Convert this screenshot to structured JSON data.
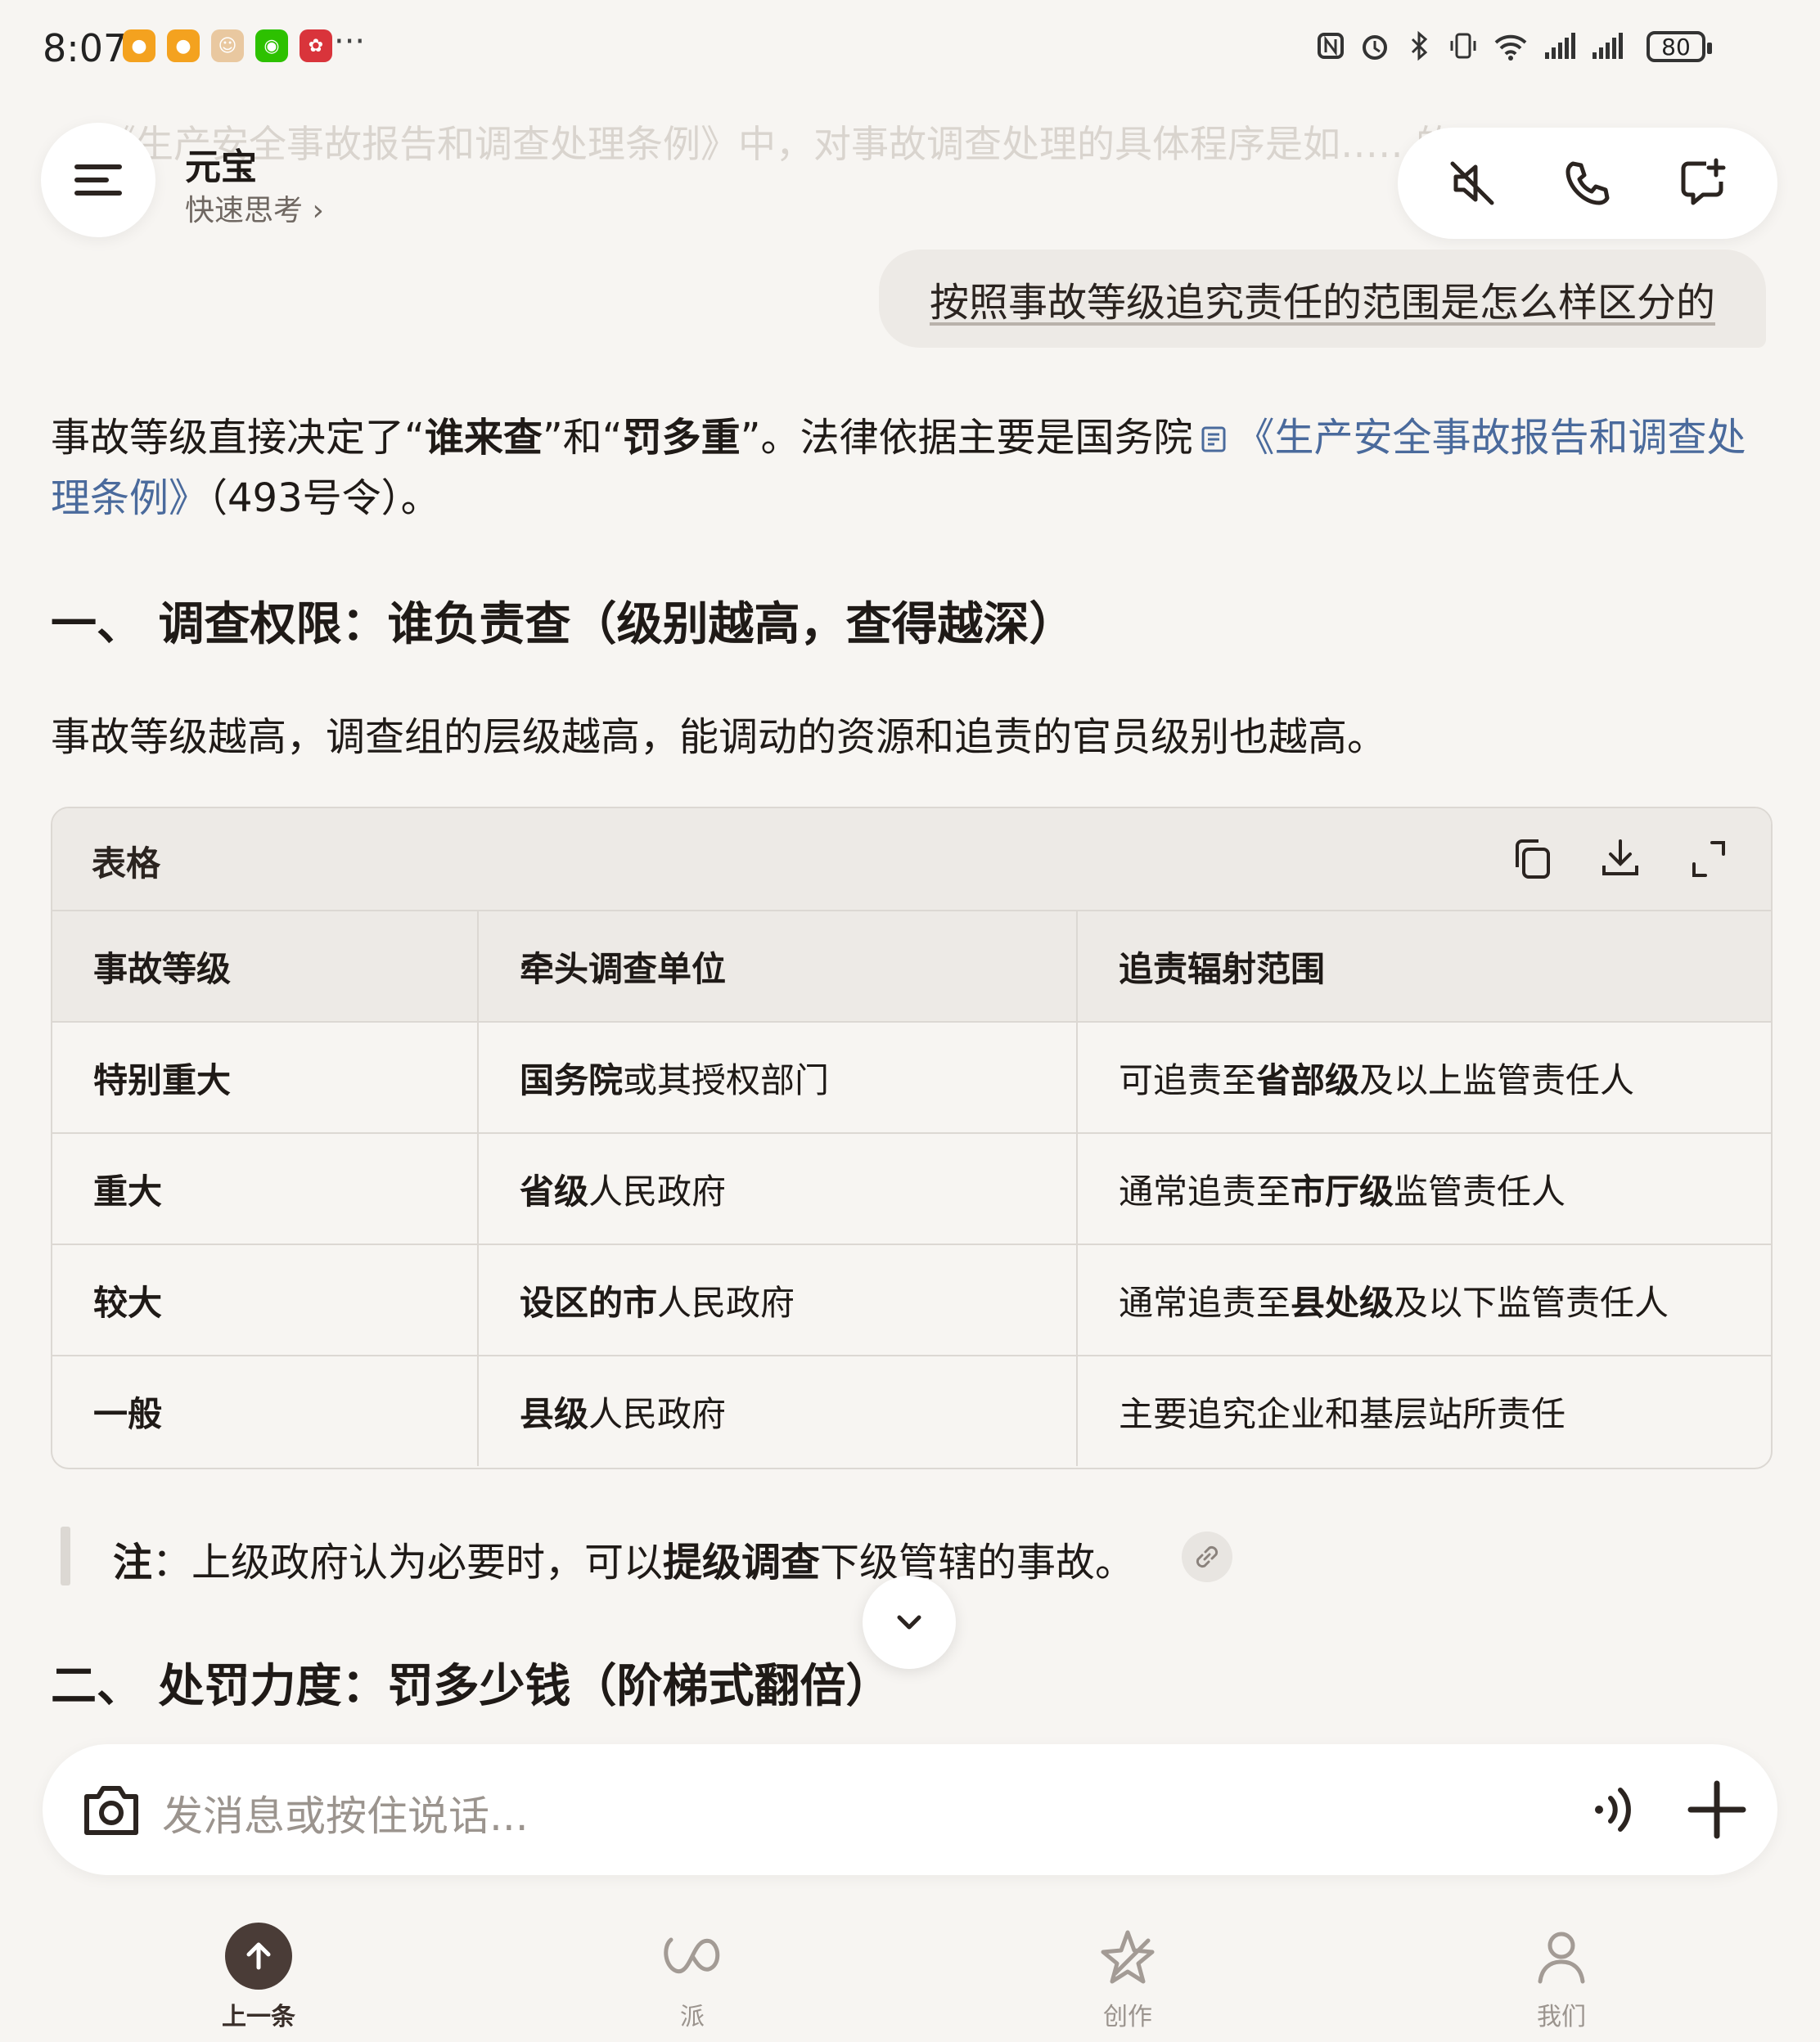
{
  "status_bar": {
    "time": "8:07",
    "more": "···",
    "battery": "80"
  },
  "ghost_text": "《生产安全事故报告和调查处理条例》中，对事故调查处理的具体程序是如……的？",
  "header": {
    "title": "元宝",
    "subtitle": "快速思考 ›"
  },
  "user_message": "按照事故等级追究责任的范围是怎么样区分的",
  "answer": {
    "intro": {
      "p1": "事故等级直接决定了“",
      "b1": "谁来查",
      "p2": "”和“",
      "b2": "罚多重",
      "p3": "”。法律依据主要是国务院",
      "link": "《生产安全事故报告和调查处理条例》",
      "p4": "（493号令）。"
    },
    "section1_title": "一、 调查权限：谁负责查（级别越高，查得越深）",
    "section1_desc": "事故等级越高，调查组的层级越高，能调动的资源和追责的官员级别也越高。",
    "table": {
      "label": "表格",
      "headers": [
        "事故等级",
        "牵头调查单位",
        "追责辐射范围"
      ],
      "rows": [
        {
          "level": "特别重大",
          "unit_b": "国务院",
          "unit": "或其授权部门",
          "scope_a": "可追责至",
          "scope_b": "省部级",
          "scope_c": "及以上监管责任人"
        },
        {
          "level": "重大",
          "unit_b": "省级",
          "unit": "人民政府",
          "scope_a": "通常追责至",
          "scope_b": "市厅级",
          "scope_c": "监管责任人"
        },
        {
          "level": "较大",
          "unit_b": "设区的市",
          "unit": "人民政府",
          "scope_a": "通常追责至",
          "scope_b": "县处级",
          "scope_c": "及以下监管责任人"
        },
        {
          "level": "一般",
          "unit_b": "县级",
          "unit": "人民政府",
          "scope_a": "主要追究企业和基层站所责任",
          "scope_b": "",
          "scope_c": ""
        }
      ]
    },
    "note": {
      "label": "注",
      "a": "：上级政府认为必要时，可以",
      "b": "提级调查",
      "c": "下级管辖的事故。"
    },
    "section2_title": "二、 处罚力度：罚多少钱（阶梯式翻倍）"
  },
  "input": {
    "placeholder": "发消息或按住说话..."
  },
  "nav": {
    "items": [
      "上一条",
      "派",
      "创作",
      "我们"
    ]
  },
  "colors": {
    "background": "#f7f5f2",
    "link": "#4a6a9c",
    "active_nav": "#4a3c37"
  }
}
